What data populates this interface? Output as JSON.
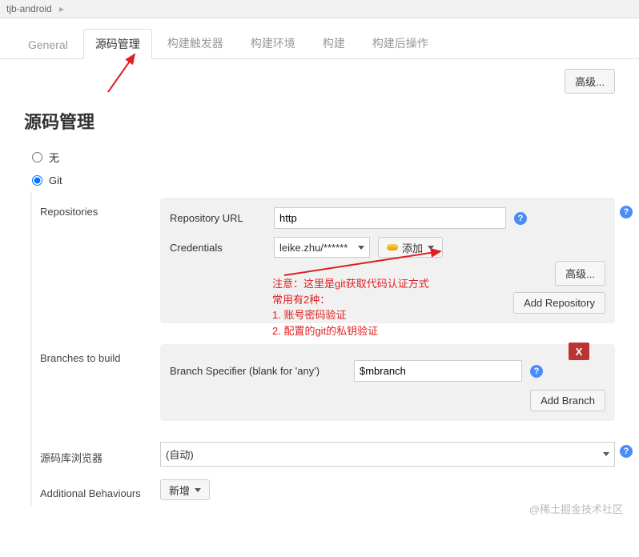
{
  "breadcrumb": {
    "project": "tjb-android"
  },
  "tabs": {
    "general": "General",
    "scm": "源码管理",
    "triggers": "构建触发器",
    "env": "构建环境",
    "build": "构建",
    "post": "构建后操作"
  },
  "buttons": {
    "advanced": "高级...",
    "add_repo": "Add Repository",
    "add_branch": "Add Branch",
    "add_cred": "添加",
    "add_behaviour": "新增"
  },
  "section": {
    "title": "源码管理"
  },
  "scm": {
    "none": "无",
    "git": "Git",
    "repos_label": "Repositories",
    "repo_url_label": "Repository URL",
    "repo_url_value": "http",
    "cred_label": "Credentials",
    "cred_value": "leike.zhu/******",
    "branches_label": "Branches to build",
    "branch_spec_label": "Branch Specifier (blank for 'any')",
    "branch_spec_value": "$mbranch",
    "browser_label": "源码库浏览器",
    "browser_value": "(自动)",
    "behaviours_label": "Additional Behaviours"
  },
  "annotations": {
    "note1": "注意：这里是git获取代码认证方式",
    "note2": "常用有2种：",
    "note3": "1. 账号密码验证",
    "note4": "2. 配置的git的私钥验证"
  },
  "watermark": "@稀土掘金技术社区"
}
